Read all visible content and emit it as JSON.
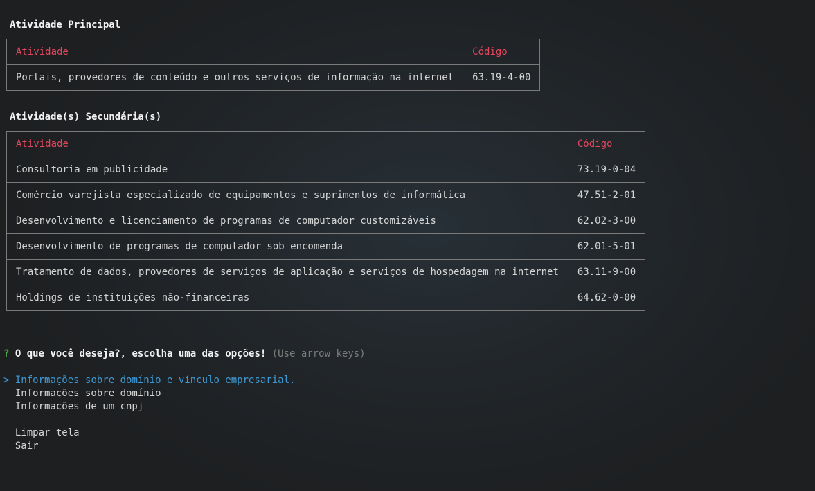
{
  "main_activity": {
    "title": "Atividade Principal",
    "headers": {
      "activity": "Atividade",
      "code": "Código"
    },
    "rows": [
      {
        "activity": "Portais, provedores de conteúdo e outros serviços de informação na internet",
        "code": "63.19-4-00"
      }
    ]
  },
  "secondary_activities": {
    "title": "Atividade(s) Secundária(s)",
    "headers": {
      "activity": "Atividade",
      "code": "Código"
    },
    "rows": [
      {
        "activity": "Consultoria em publicidade",
        "code": "73.19-0-04"
      },
      {
        "activity": "Comércio varejista especializado de equipamentos e suprimentos de informática",
        "code": "47.51-2-01"
      },
      {
        "activity": "Desenvolvimento e licenciamento de programas de computador customizáveis",
        "code": "62.02-3-00"
      },
      {
        "activity": "Desenvolvimento de programas de computador sob encomenda",
        "code": "62.01-5-01"
      },
      {
        "activity": "Tratamento de dados, provedores de serviços de aplicação e serviços de hospedagem na internet",
        "code": "63.11-9-00"
      },
      {
        "activity": "Holdings de instituições não-financeiras",
        "code": "64.62-0-00"
      }
    ]
  },
  "prompt": {
    "mark": "?",
    "question": "O que você deseja?, escolha uma das opções!",
    "hint": "(Use arrow keys)",
    "pointer": ">",
    "options": [
      "Informações sobre domínio e vínculo empresarial.",
      "Informações sobre domínio",
      "Informações de um cnpj",
      "Limpar tela",
      "Sair"
    ]
  },
  "colors": {
    "header_text": "#e0475d",
    "selected_option": "#3d9ad6",
    "question_mark": "#4cae4c",
    "hint_text": "#7d7d7d",
    "table_border": "#7a7a7a"
  }
}
